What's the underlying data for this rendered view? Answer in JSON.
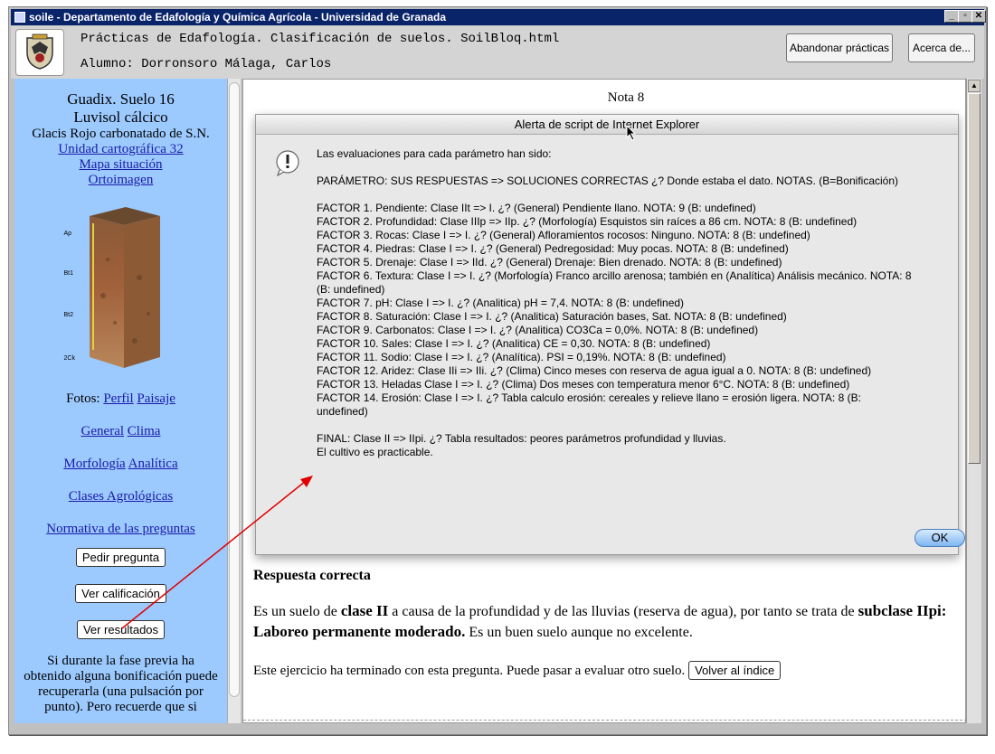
{
  "window": {
    "title": "soile - Departamento de Edafología y Química Agrícola - Universidad de Granada"
  },
  "header": {
    "line1": "Prácticas de Edafología. Clasificación de suelos. SoilBloq.html",
    "line2": "Alumno: Dorronsoro Málaga, Carlos",
    "btn_leave": "Abandonar prácticas",
    "btn_about": "Acerca de..."
  },
  "left": {
    "title1": "Guadix. Suelo 16",
    "title2": "Luvisol cálcico",
    "subtitle": "Glacis Rojo carbonatado de S.N.",
    "link_unit": "Unidad cartográfica 32",
    "link_map": "Mapa situación",
    "link_ortho": "Ortoimagen ",
    "horizons": [
      "Ap",
      "Bt1",
      "Bt2",
      "2Ck"
    ],
    "fotos_label": "Fotos:",
    "link_perfil": "Perfil",
    "link_paisaje": "Paisaje",
    "link_general": "General",
    "link_clima": "Clima",
    "link_morfologia": "Morfología",
    "link_analitica": "Analítica",
    "link_clases": "Clases Agrológicas",
    "link_normativa": "Normativa de las preguntas",
    "btn_pedir": "Pedir pregunta",
    "btn_calif": "Ver calificación",
    "btn_result": "Ver resultados",
    "note": "Si durante la fase previa ha obtenido alguna bonificación puede recuperarla (una pulsación por punto). Pero recuerde que si"
  },
  "page": {
    "nota": "Nota 8"
  },
  "dialog": {
    "title": "Alerta de script de Internet Explorer",
    "lines": [
      "Las evaluaciones para cada parámetro han sido:",
      "",
      "PARÁMETRO: SUS RESPUESTAS => SOLUCIONES CORRECTAS ¿? Donde estaba el dato. NOTAS. (B=Bonificación)",
      "",
      "FACTOR 1. Pendiente: Clase IIt => I. ¿? (General) Pendiente llano. NOTA: 9 (B: undefined)",
      "FACTOR 2. Profundidad: Clase IIIp => IIp. ¿? (Morfología) Esquistos sin raíces a 86 cm.  NOTA: 8 (B: undefined)",
      "FACTOR 3. Rocas: Clase I => I. ¿? (General) Afloramientos rocosos: Ninguno.  NOTA: 8 (B: undefined)",
      "FACTOR 4. Piedras: Clase I => I. ¿? (General) Pedregosidad: Muy pocas.  NOTA: 8 (B: undefined)",
      "FACTOR 5. Drenaje: Clase I  => IId. ¿? (General) Drenaje: Bien drenado.  NOTA: 8 (B: undefined)",
      "FACTOR 6. Textura:  Clase I => I. ¿? (Morfología) Franco arcillo arenosa; también en (Analítica) Análisis mecánico.  NOTA: 8",
      "(B: undefined)",
      "FACTOR 7. pH: Clase I => I. ¿? (Analitica) pH = 7,4.  NOTA: 8 (B: undefined)",
      "FACTOR 8. Saturación: Clase I => I. ¿? (Analitica) Saturación bases, Sat.  NOTA: 8 (B: undefined)",
      "FACTOR 9. Carbonatos:  Clase I => I. ¿? (Analitica) CO3Ca = 0,0%.  NOTA: 8 (B: undefined)",
      "FACTOR 10. Sales:  Clase I => I. ¿? (Analitica) CE = 0,30.  NOTA: 8 (B: undefined)",
      "FACTOR 11. Sodio: Clase I => I. ¿? (Analítica). PSI = 0,19%.  NOTA: 8 (B: undefined)",
      "FACTOR 12. Aridez:  Clase IIi => IIi. ¿? (Clima) Cinco meses con reserva de agua igual a 0.  NOTA: 8 (B: undefined)",
      "FACTOR 13. Heladas  Clase I => I. ¿? (Clima) Dos meses con temperatura menor 6°C.  NOTA: 8 (B: undefined)",
      "FACTOR 14. Erosión:  Clase I => I. ¿?  Tabla calculo erosión: cereales y relieve llano = erosión ligera.  NOTA: 8 (B:",
      "undefined)",
      "",
      "FINAL: Clase II => IIpi. ¿? Tabla resultados: peores parámetros profundidad y lluvias.",
      "El cultivo es practicable."
    ],
    "ok": "OK"
  },
  "response": {
    "heading": "Respuesta correcta",
    "p1_a": "Es un suelo de ",
    "p1_b": "clase II",
    "p1_c": " a causa de la profundidad y de las lluvias (reserva de agua), por tanto se trata de ",
    "p1_d": "subclase IIpi: Laboreo permanente moderado.",
    "p1_e": " Es un buen suelo aunque no excelente.",
    "p2": "Este ejercicio ha terminado con esta pregunta. Puede pasar a evaluar otro suelo.",
    "btn_index": "Volver al índice"
  },
  "colors": {
    "left_bg": "#9ccaff",
    "titlebar": "#0a246a",
    "link": "#1a1aa6",
    "arrow": "#e00000"
  }
}
